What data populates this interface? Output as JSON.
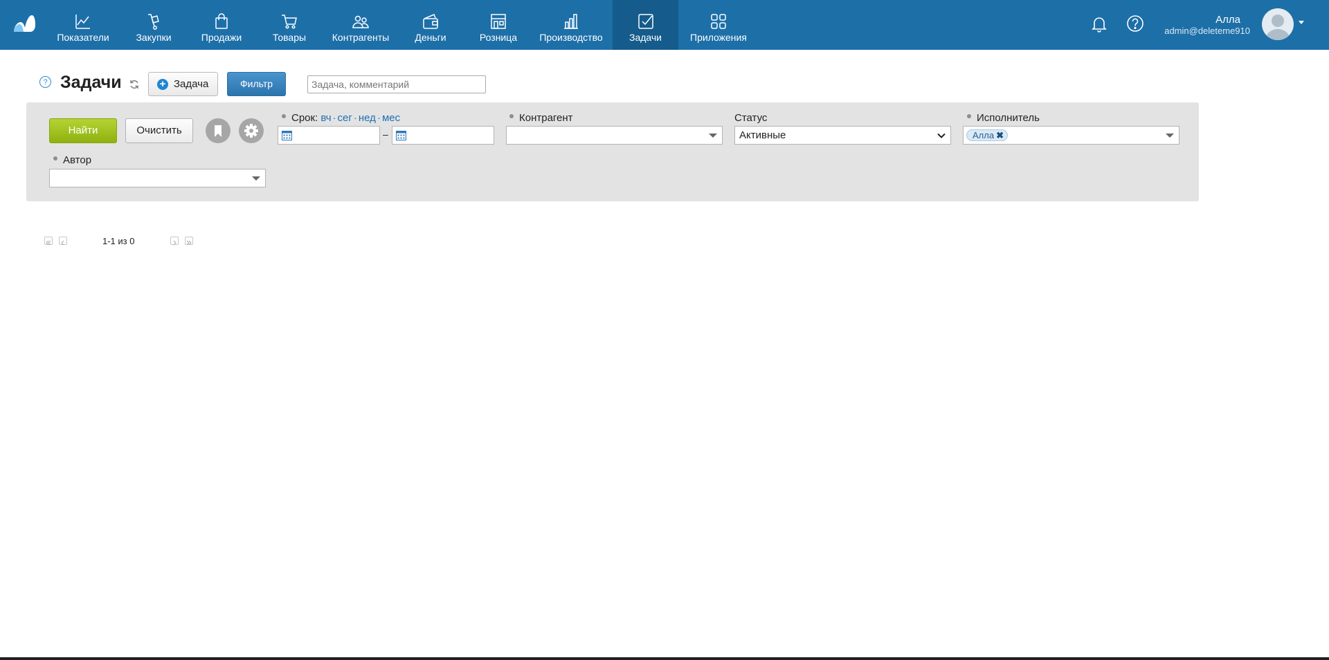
{
  "nav": {
    "items": [
      {
        "label": "Показатели",
        "icon": "chart-line-icon"
      },
      {
        "label": "Закупки",
        "icon": "hand-truck-icon"
      },
      {
        "label": "Продажи",
        "icon": "shopping-bag-icon"
      },
      {
        "label": "Товары",
        "icon": "cart-icon"
      },
      {
        "label": "Контрагенты",
        "icon": "people-icon"
      },
      {
        "label": "Деньги",
        "icon": "wallet-icon"
      },
      {
        "label": "Розница",
        "icon": "store-icon"
      },
      {
        "label": "Производство",
        "icon": "factory-icon"
      },
      {
        "label": "Задачи",
        "icon": "checkbox-icon",
        "active": true
      },
      {
        "label": "Приложения",
        "icon": "apps-icon"
      }
    ]
  },
  "user": {
    "name": "Алла",
    "email": "admin@deleteme910"
  },
  "header": {
    "help": "?",
    "title": "Задачи",
    "add_task_label": "Задача",
    "filter_label": "Фильтр",
    "search_placeholder": "Задача, комментарий"
  },
  "filter": {
    "find_label": "Найти",
    "clear_label": "Очистить",
    "period": {
      "label": "Срок:",
      "links": [
        "вч",
        "сег",
        "нед",
        "мес"
      ],
      "from": "",
      "to": "",
      "separator": "–"
    },
    "counterparty": {
      "label": "Контрагент",
      "value": ""
    },
    "status": {
      "label": "Статус",
      "value": "Активные"
    },
    "assignee": {
      "label": "Исполнитель",
      "tags": [
        "Алла"
      ]
    },
    "author": {
      "label": "Автор",
      "value": ""
    }
  },
  "pager": {
    "text": "1-1 из 0"
  },
  "colors": {
    "topbar": "#1d6fa8",
    "active_tab": "#155b8b",
    "accent_green": "#9cbf1a",
    "link": "#1f6fb3"
  }
}
